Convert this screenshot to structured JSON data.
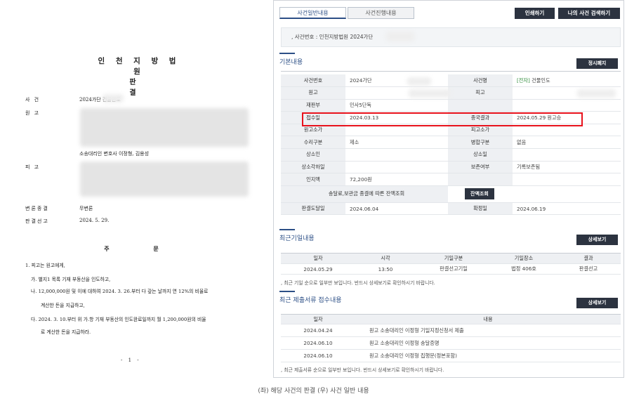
{
  "document": {
    "court": "인 천 지 방 법 원",
    "title": "판 결",
    "rows": [
      {
        "label": "사   건",
        "value": "2024가단        건물인도"
      },
      {
        "label": "원   고",
        "value": ""
      },
      {
        "label": "",
        "value": "소송대리인 변호사 이정형, 김용성"
      },
      {
        "label": "피   고",
        "value": ""
      },
      {
        "label": "변론종결",
        "value": "무변론"
      },
      {
        "label": "판결선고",
        "value": "2024. 5. 29."
      }
    ],
    "order_title": "주 문",
    "order_lines": [
      "1. 피고는 원고에게,",
      "가. 별지1 목록 기재 부동산을 인도하고,",
      "나. 12,000,000원 및 이에 대하여 2024. 3. 26.부터 다 갚는 날까지 연 12%의 비율로",
      "계산한 돈을 지급하고,",
      "다. 2024. 3. 10.부터 위 가.항 기재 부동산의 인도완료일까지 월 1,200,000원의 비율",
      "로 계산한 돈을 지급하라."
    ],
    "page_number": "- 1 -"
  },
  "ui": {
    "tabs": [
      "사건일반내용",
      "사건진행내용"
    ],
    "print_button": "인쇄하기",
    "my_search_button": "나의 사건 검색하기",
    "case_bar": ", 사건번호 : 인천지방법원 2024가단",
    "basic_section": "기본내용",
    "correct_button": "정시폐지",
    "basic": {
      "case_no_label": "사건번호",
      "case_no": "2024가단",
      "case_name_label": "사건명",
      "case_name_tag": "[전자]",
      "case_name": "건물인도",
      "plaintiff_label": "원고",
      "defendant_label": "피고",
      "division_label": "재판부",
      "division": "민사5단독",
      "receipt_label": "접수일",
      "receipt": "2024.03.13",
      "result_label": "종국결과",
      "result": "2024.05.29 원고승",
      "plaintiff_value_label": "원고소가",
      "defendant_value_label": "피고소가",
      "stamp_label": "수리구분",
      "stamp": "제소",
      "merge_label": "병합구분",
      "merge": "없음",
      "appeal_label": "상소인",
      "appellee_label": "상소일",
      "appeal_reject_label": "상소각하일",
      "preserve_label": "보존여부",
      "preserve": "기록보존됨",
      "stamp_fee_label": "인지액",
      "stamp_fee": "72,200원",
      "balance_label": "송달료,보관금 종결에 따른 잔액조회",
      "balance_button": "잔액조회",
      "final_date_label": "판결도달일",
      "final_date": "2024.06.04",
      "confirm_label": "확정일",
      "confirm": "2024.06.19"
    },
    "recent_hearing_section": "최근기일내용",
    "detail_button": "상세보기",
    "hearing_headers": [
      "일자",
      "시각",
      "기일구분",
      "기일장소",
      "결과"
    ],
    "hearing_rows": [
      [
        "2024.05.29",
        "13:50",
        "판결선고기일",
        "법정 406호",
        "판결선고"
      ]
    ],
    "hearing_note": ", 최근 기일 순으로 일부만 보입니다. 반드시 상세보기로 확인하시기 바랍니다.",
    "recent_docs_section": "최근 제출서류 접수내용",
    "docs_headers": [
      "일자",
      "내용"
    ],
    "docs_rows": [
      [
        "2024.04.24",
        "원고 소송대리인 이정형 기일지정신청서 제출"
      ],
      [
        "2024.06.10",
        "원고 소송대리인 이정형 송달증명"
      ],
      [
        "2024.06.10",
        "원고 소송대리인 이정형 집행문(정본포함)"
      ]
    ],
    "docs_note": ", 최근 제출서류 순으로 일부만 보입니다. 반드시 상세보기로 확인하시기 바랍니다."
  },
  "caption": "(좌) 해당 사건의 판결 (우) 사건 일반 내용"
}
